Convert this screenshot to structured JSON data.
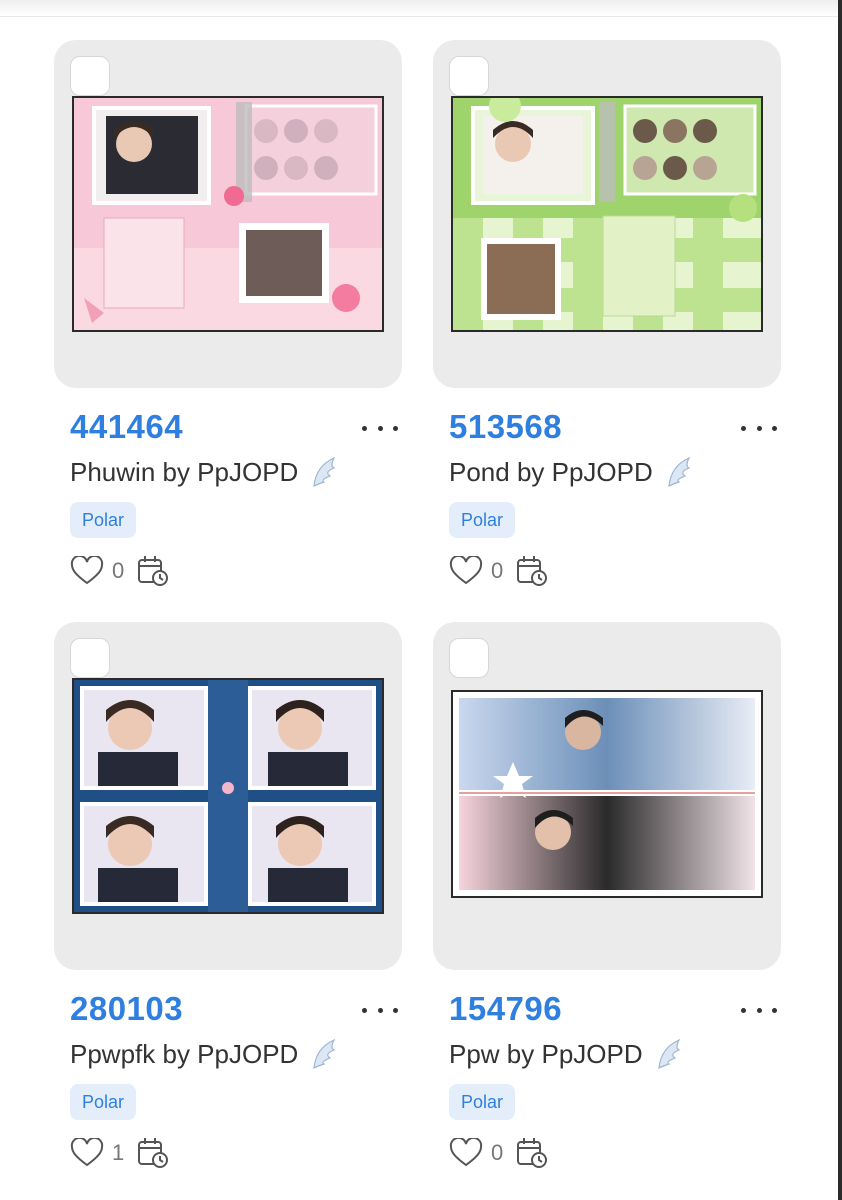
{
  "cards": [
    {
      "code": "441464",
      "title": "Phuwin by PpJOPD",
      "badge": "Polar",
      "likes": "0",
      "theme": "pink"
    },
    {
      "code": "513568",
      "title": "Pond by PpJOPD",
      "badge": "Polar",
      "likes": "0",
      "theme": "green"
    },
    {
      "code": "280103",
      "title": "Ppwpfk by PpJOPD",
      "badge": "Polar",
      "likes": "1",
      "theme": "navy"
    },
    {
      "code": "154796",
      "title": "Ppw by PpJOPD",
      "badge": "Polar",
      "likes": "0",
      "theme": "duo"
    }
  ],
  "colors": {
    "accent": "#2f7fe0",
    "badge_bg": "#e3eefa",
    "card_bg": "#ebebeb"
  },
  "icons": [
    "checkbox",
    "more-icon",
    "wing-icon",
    "heart-icon",
    "calendar-clock-icon"
  ]
}
